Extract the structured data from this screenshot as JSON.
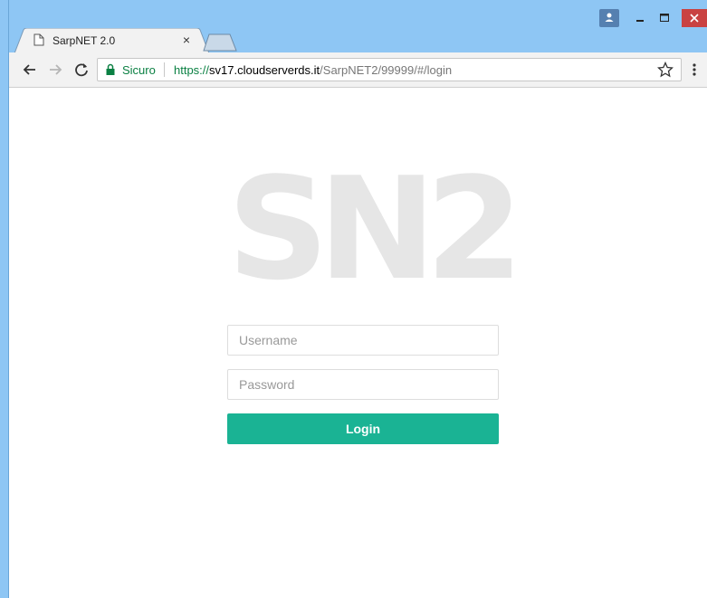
{
  "browser": {
    "tab": {
      "title": "SarpNET 2.0",
      "close": "×"
    },
    "omnibox": {
      "secure_label": "Sicuro",
      "url_scheme": "https://",
      "url_host": "sv17.cloudserverds.it",
      "url_path": "/SarpNET2/99999/#/login"
    },
    "icons": [
      "document-icon",
      "close-icon",
      "new-tab-icon",
      "user-icon",
      "minimize-icon",
      "maximize-icon",
      "window-close-icon",
      "back-arrow-icon",
      "forward-arrow-icon",
      "reload-icon",
      "lock-icon",
      "star-icon",
      "menu-icon"
    ],
    "colors": {
      "chrome_frame": "#8ec6f4",
      "secure_green": "#0b8043",
      "window_close_red": "#c94242"
    }
  },
  "page": {
    "logo_text": "SN2",
    "username": {
      "placeholder": "Username",
      "value": ""
    },
    "password": {
      "placeholder": "Password",
      "value": ""
    },
    "login_label": "Login",
    "colors": {
      "login_button": "#1ab394",
      "logo": "#e6e6e6"
    }
  }
}
